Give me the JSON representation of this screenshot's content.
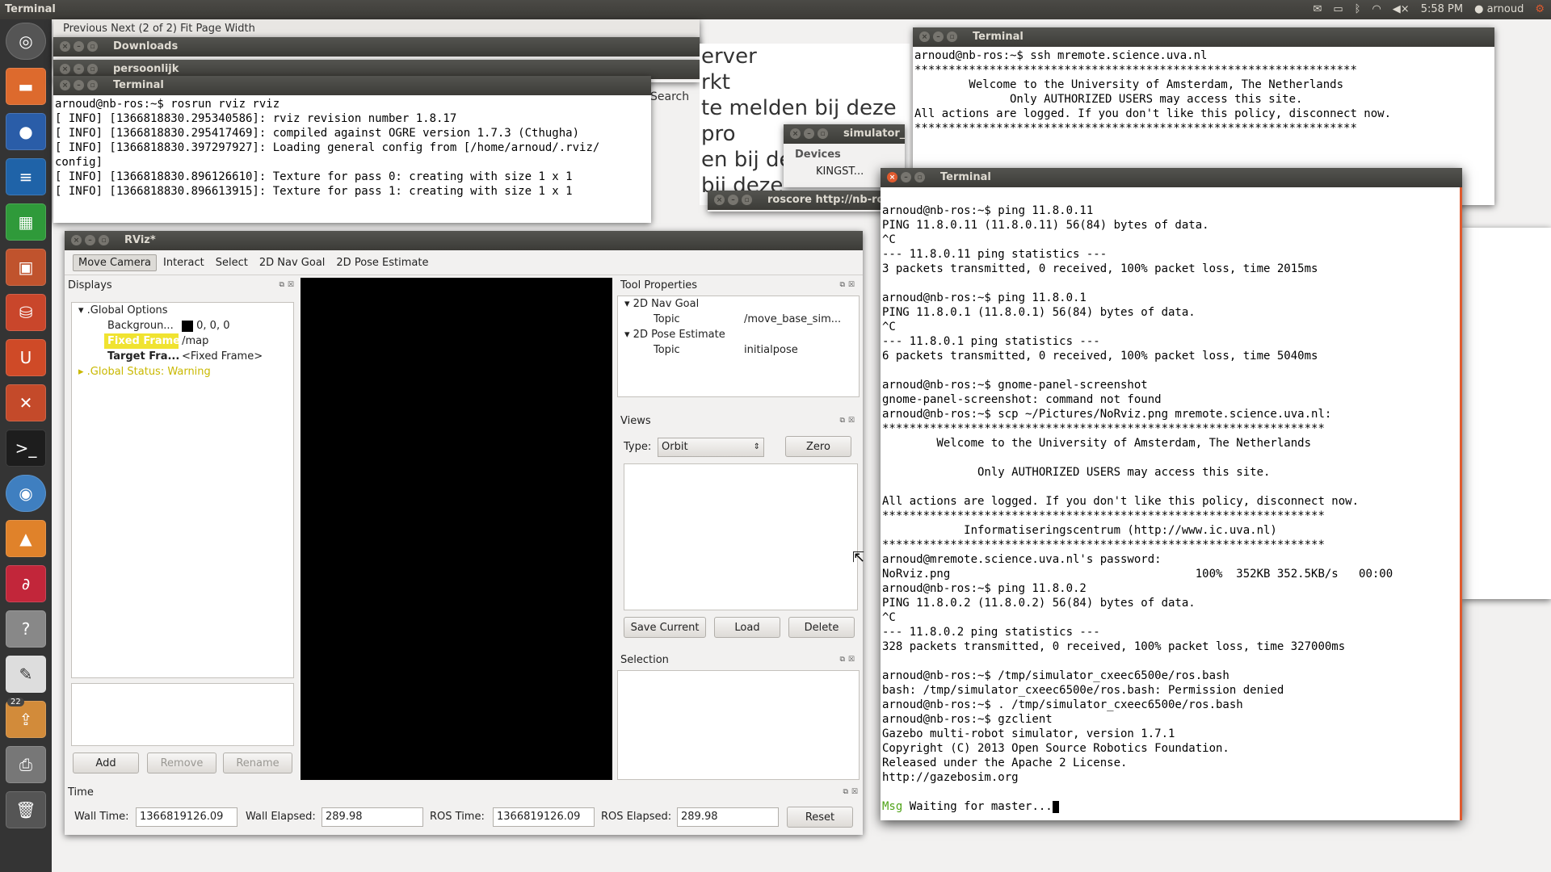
{
  "topbar": {
    "app_title": "Terminal",
    "time": "5:58 PM",
    "user": "arnoud"
  },
  "launcher": {
    "badge_count": "22"
  },
  "bg_windows": {
    "downloads_title": "Downloads",
    "persoonlijk_title": "persoonlijk",
    "doc_toolbar": "Previous   Next   (2 of 2)   Fit Page Width",
    "search_label": "Search",
    "bg_text_lines": [
      "erver",
      "rkt",
      "te melden bij deze pro",
      "en bij de",
      "bij deze"
    ],
    "simulator_title": "simulator_c",
    "devices_label": "Devices",
    "device_item": "KINGST...",
    "roscore_title": "roscore http://nb-ros"
  },
  "term_rviz": {
    "title": "Terminal",
    "lines": [
      "arnoud@nb-ros:~$ rosrun rviz rviz",
      "[ INFO] [1366818830.295340586]: rviz revision number 1.8.17",
      "[ INFO] [1366818830.295417469]: compiled against OGRE version 1.7.3 (Cthugha)",
      "[ INFO] [1366818830.397297927]: Loading general config from [/home/arnoud/.rviz/",
      "config]",
      "[ INFO] [1366818830.896126610]: Texture for pass 0: creating with size 1 x 1",
      "[ INFO] [1366818830.896613915]: Texture for pass 1: creating with size 1 x 1"
    ]
  },
  "term_ssh": {
    "title": "Terminal",
    "lines": [
      "arnoud@nb-ros:~$ ssh mremote.science.uva.nl",
      "*****************************************************************",
      "        Welcome to the University of Amsterdam, The Netherlands",
      "",
      "              Only AUTHORIZED USERS may access this site.",
      "",
      "All actions are logged. If you don't like this policy, disconnect now.",
      "*****************************************************************"
    ]
  },
  "term_main": {
    "title": "Terminal",
    "lines": [
      "",
      "arnoud@nb-ros:~$ ping 11.8.0.11",
      "PING 11.8.0.11 (11.8.0.11) 56(84) bytes of data.",
      "^C",
      "--- 11.8.0.11 ping statistics ---",
      "3 packets transmitted, 0 received, 100% packet loss, time 2015ms",
      "",
      "arnoud@nb-ros:~$ ping 11.8.0.1",
      "PING 11.8.0.1 (11.8.0.1) 56(84) bytes of data.",
      "^C",
      "--- 11.8.0.1 ping statistics ---",
      "6 packets transmitted, 0 received, 100% packet loss, time 5040ms",
      "",
      "arnoud@nb-ros:~$ gnome-panel-screenshot",
      "gnome-panel-screenshot: command not found",
      "arnoud@nb-ros:~$ scp ~/Pictures/NoRviz.png mremote.science.uva.nl:",
      "*****************************************************************",
      "        Welcome to the University of Amsterdam, The Netherlands",
      "",
      "              Only AUTHORIZED USERS may access this site.",
      "",
      "All actions are logged. If you don't like this policy, disconnect now.",
      "*****************************************************************",
      "            Informatiseringscentrum (http://www.ic.uva.nl)",
      "*****************************************************************",
      "arnoud@mremote.science.uva.nl's password:",
      "NoRviz.png                                    100%  352KB 352.5KB/s   00:00",
      "arnoud@nb-ros:~$ ping 11.8.0.2",
      "PING 11.8.0.2 (11.8.0.2) 56(84) bytes of data.",
      "^C",
      "--- 11.8.0.2 ping statistics ---",
      "328 packets transmitted, 0 received, 100% packet loss, time 327000ms",
      "",
      "arnoud@nb-ros:~$ /tmp/simulator_cxeec6500e/ros.bash",
      "bash: /tmp/simulator_cxeec6500e/ros.bash: Permission denied",
      "arnoud@nb-ros:~$ . /tmp/simulator_cxeec6500e/ros.bash",
      "arnoud@nb-ros:~$ gzclient",
      "Gazebo multi-robot simulator, version 1.7.1",
      "Copyright (C) 2013 Open Source Robotics Foundation.",
      "Released under the Apache 2 License.",
      "http://gazebosim.org",
      ""
    ],
    "msg_tag": "Msg",
    "last_line": " Waiting for master..."
  },
  "rviz": {
    "title": "RViz*",
    "tools": [
      "Move Camera",
      "Interact",
      "Select",
      "2D Nav Goal",
      "2D Pose Estimate"
    ],
    "displays": {
      "title": "Displays",
      "global_options": ".Global Options",
      "background_label": "Backgroun...",
      "background_value": "0, 0, 0",
      "fixed_frame_label": "Fixed Frame",
      "fixed_frame_value": "/map",
      "target_frame_label": "Target Fra...",
      "target_frame_value": "<Fixed Frame>",
      "global_status": ".Global Status: Warning",
      "add": "Add",
      "remove": "Remove",
      "rename": "Rename"
    },
    "tool_props": {
      "title": "Tool Properties",
      "nav_goal": "2D Nav Goal",
      "nav_topic_label": "Topic",
      "nav_topic_value": "/move_base_sim...",
      "pose_estimate": "2D Pose Estimate",
      "pose_topic_label": "Topic",
      "pose_topic_value": "initialpose"
    },
    "views": {
      "title": "Views",
      "type_label": "Type:",
      "type_value": "Orbit",
      "zero": "Zero",
      "save_current": "Save Current",
      "load": "Load",
      "delete": "Delete"
    },
    "selection": {
      "title": "Selection"
    },
    "time": {
      "title": "Time",
      "wall_time_label": "Wall Time:",
      "wall_time": "1366819126.09",
      "wall_elapsed_label": "Wall Elapsed:",
      "wall_elapsed": "289.98",
      "ros_time_label": "ROS Time:",
      "ros_time": "1366819126.09",
      "ros_elapsed_label": "ROS Elapsed:",
      "ros_elapsed": "289.98",
      "reset": "Reset"
    }
  },
  "colors": {
    "accent": "#e05a2e",
    "warning": "#c9b800",
    "fixed_frame_highlight": "#f0e330",
    "msg_green": "#4fa318"
  }
}
